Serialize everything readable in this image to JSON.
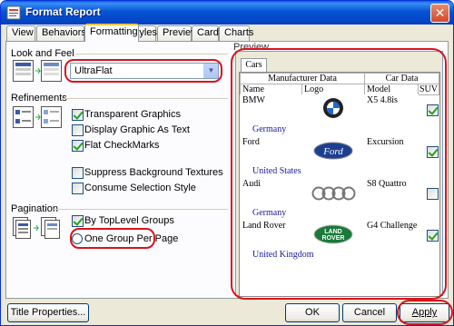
{
  "window": {
    "title": "Format Report",
    "close_icon": "close-icon"
  },
  "tabs": [
    {
      "label": "View"
    },
    {
      "label": "Behaviors"
    },
    {
      "label": "Formatting"
    },
    {
      "label": "Styles"
    },
    {
      "label": "Preview"
    },
    {
      "label": "Cards"
    },
    {
      "label": "Charts"
    }
  ],
  "active_tab": "Formatting",
  "look_and_feel": {
    "section_label": "Look and Feel",
    "style_value": "UltraFlat"
  },
  "refinements": {
    "section_label": "Refinements",
    "options": [
      {
        "label": "Transparent Graphics",
        "checked": true
      },
      {
        "label": "Display Graphic As Text",
        "checked": false
      },
      {
        "label": "Flat CheckMarks",
        "checked": true
      },
      {
        "label": "Suppress Background Textures",
        "checked": false
      },
      {
        "label": "Consume Selection Style",
        "checked": false
      }
    ]
  },
  "pagination": {
    "section_label": "Pagination",
    "options": [
      {
        "label": "By TopLevel Groups",
        "selected": false
      },
      {
        "label": "One Group Per Page",
        "selected": false
      }
    ]
  },
  "preview": {
    "section_label": "Preview",
    "tab_label": "Cars",
    "group_headers": {
      "manufacturer": "Manufacturer Data",
      "car": "Car Data"
    },
    "columns": {
      "name": "Name",
      "logo": "Logo",
      "model": "Model",
      "suv": "SUV"
    },
    "rows": [
      {
        "name": "BMW",
        "model": "X5 4.8is",
        "suv": true,
        "country": "Germany",
        "logo": "bmw-logo"
      },
      {
        "name": "Ford",
        "model": "Excursion",
        "suv": true,
        "country": "United States",
        "logo": "ford-logo"
      },
      {
        "name": "Audi",
        "model": "S8 Quattro",
        "suv": false,
        "country": "Germany",
        "logo": "audi-logo"
      },
      {
        "name": "Land Rover",
        "model": "G4 Challenge",
        "suv": true,
        "country": "United Kingdom",
        "logo": "land-rover-logo"
      }
    ],
    "logo_text": {
      "ford": "Ford",
      "land_rover_top": "LAND",
      "land_rover_bottom": "ROVER"
    }
  },
  "buttons": {
    "title_properties": "Title Properties...",
    "ok": "OK",
    "cancel": "Cancel",
    "apply": "Apply"
  },
  "colors": {
    "titlebar": "#0553d6",
    "annotation": "#d8141c",
    "country_text": "#1a1a9c",
    "check": "#21a121"
  }
}
